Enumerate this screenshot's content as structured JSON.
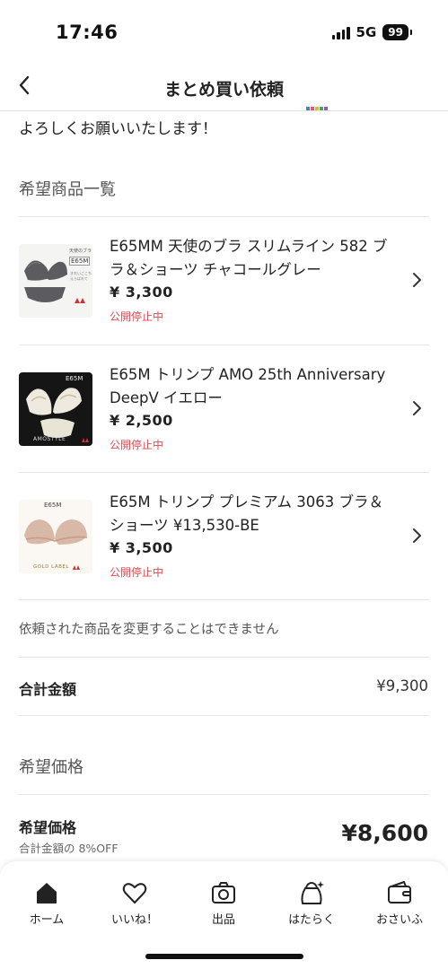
{
  "status_bar": {
    "time": "17:46",
    "network": "5G",
    "battery": "99"
  },
  "header": {
    "title": "まとめ買い依頼"
  },
  "content": {
    "greeting": "よろしくお願いいたします！",
    "products_section_title": "希望商品一覧",
    "products": [
      {
        "title": "E65MM 天使のブラ スリムライン 582 ブラ＆ショーツ チャコールグレー",
        "price": "¥ 3,300",
        "status": "公開停止中",
        "thumb_labels": [
          "天使のブラ",
          "E65M",
          "きれいごこち",
          "えらばれて"
        ]
      },
      {
        "title": "E65M トリンプ AMO 25th Anniversary DeepV イエロー",
        "price": "¥ 2,500",
        "status": "公開停止中",
        "thumb_labels": [
          "E65M",
          "AMOSTYLE"
        ]
      },
      {
        "title": "E65M トリンプ プレミアム 3063 ブラ＆ショーツ ¥13,530-BE",
        "price": "¥ 3,500",
        "status": "公開停止中",
        "thumb_labels": [
          "E65M",
          "GOLD LABEL"
        ]
      }
    ],
    "change_note": "依頼された商品を変更することはできません",
    "total": {
      "label": "合計金額",
      "value": "¥9,300"
    },
    "hope_section_title": "希望価格",
    "hope": {
      "label": "希望価格",
      "sub": "合計金額の 8%OFF",
      "value": "¥8,600"
    }
  },
  "bottom_nav": {
    "items": [
      {
        "label": "ホーム",
        "icon": "home-icon"
      },
      {
        "label": "いいね！",
        "icon": "heart-icon"
      },
      {
        "label": "出品",
        "icon": "camera-icon"
      },
      {
        "label": "はたらく",
        "icon": "work-bag-icon"
      },
      {
        "label": "おさいふ",
        "icon": "wallet-icon"
      }
    ]
  },
  "colors": {
    "status_red": "#e5484d",
    "text": "#222222",
    "divider": "#e6e6e6"
  }
}
